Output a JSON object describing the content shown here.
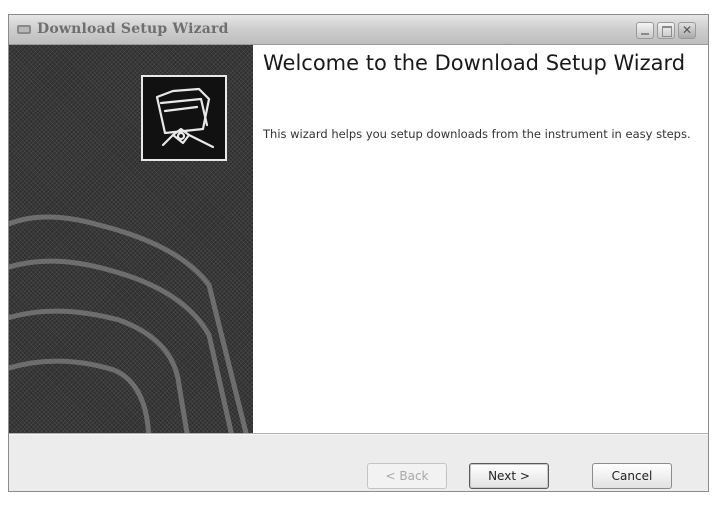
{
  "window": {
    "title": "Download Setup Wizard",
    "controls": {
      "minimize_icon": "minimize-icon",
      "maximize_icon": "maximize-icon",
      "close_icon": "close-icon",
      "close_glyph": "✕"
    }
  },
  "sidebar": {
    "icon": "folder-cable-icon",
    "background": "#2f2f2f"
  },
  "content": {
    "heading": "Welcome to the Download Setup Wizard",
    "description": "This wizard helps you setup downloads from the instrument in easy steps."
  },
  "buttons": {
    "back": "< Back",
    "next": "Next >",
    "cancel": "Cancel"
  }
}
